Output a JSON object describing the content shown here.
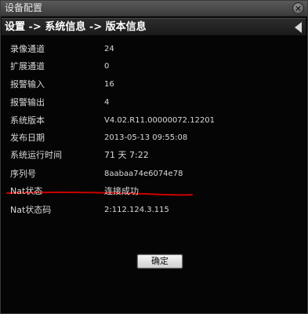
{
  "window": {
    "title": "设备配置",
    "close_icon": "close-icon"
  },
  "breadcrumb": {
    "text": "设置 -> 系统信息 -> 版本信息"
  },
  "info": {
    "rows": [
      {
        "label": "录像通道",
        "value": "24"
      },
      {
        "label": "扩展通道",
        "value": "0"
      },
      {
        "label": "报警输入",
        "value": "16"
      },
      {
        "label": "报警输出",
        "value": "4"
      },
      {
        "label": "系统版本",
        "value": "V4.02.R11.00000072.12201"
      },
      {
        "label": "发布日期",
        "value": "2013-05-13 09:55:08"
      },
      {
        "label": "系统运行时间",
        "value": "71 天 7:22"
      },
      {
        "label": "序列号",
        "value": "8aabaa74e6074e78"
      },
      {
        "label": "Nat状态",
        "value": "连接成功"
      },
      {
        "label": "Nat状态码",
        "value": "2:112.124.3.115"
      }
    ]
  },
  "annotation": {
    "color": "#cc0000"
  },
  "buttons": {
    "ok_label": "确定"
  }
}
